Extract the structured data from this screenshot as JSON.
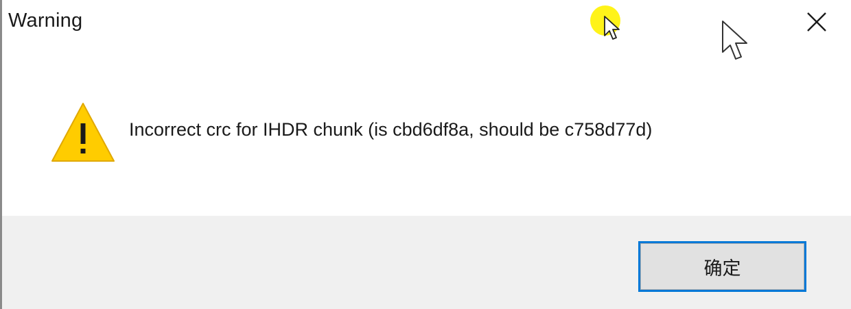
{
  "dialog": {
    "title": "Warning",
    "message": "Incorrect crc for IHDR chunk (is cbd6df8a, should be c758d77d)",
    "ok_label": "确定",
    "close_icon": "close-icon",
    "warning_icon": "warning-triangle-icon"
  },
  "colors": {
    "footer_background": "#f0f0f0",
    "button_focus_border": "#0078d7",
    "warning_yellow": "#ffcc00",
    "cursor_highlight": "#fff200"
  }
}
